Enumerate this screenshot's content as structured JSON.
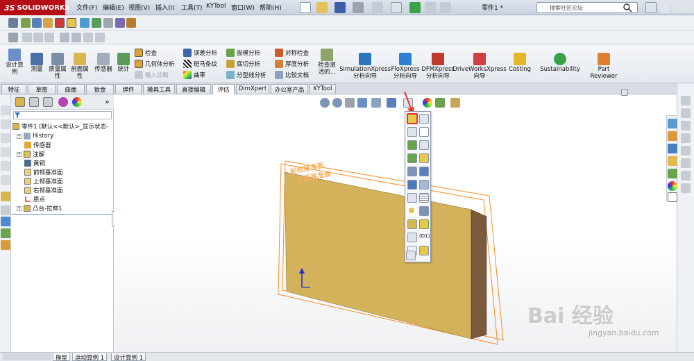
{
  "app": {
    "name": "SOLIDWORKS",
    "doc_title": "零件1 *"
  },
  "menu": [
    "文件(F)",
    "编辑(E)",
    "视图(V)",
    "插入(I)",
    "工具(T)",
    "KYTool",
    "窗口(W)",
    "帮助(H)"
  ],
  "search": {
    "placeholder": "搜索社区论坛"
  },
  "command_manager": {
    "big_buttons": [
      {
        "label": "设计算\n例"
      },
      {
        "label": "测量"
      },
      {
        "label": "质量属\n性"
      },
      {
        "label": "剖面属\n性"
      },
      {
        "label": "传感器"
      },
      {
        "label": "统计"
      }
    ],
    "col1": [
      {
        "label": "检查",
        "enabled": true
      },
      {
        "label": "几何体分析",
        "enabled": true
      },
      {
        "label": "输入诊断",
        "enabled": false
      }
    ],
    "col2": [
      {
        "label": "误差分析"
      },
      {
        "label": "斑马条纹"
      },
      {
        "label": "曲率"
      }
    ],
    "col3": [
      {
        "label": "拔模分析"
      },
      {
        "label": "底切分析"
      },
      {
        "label": "分型线分析"
      }
    ],
    "col4": [
      {
        "label": "对称检查"
      },
      {
        "label": "厚度分析"
      },
      {
        "label": "比较文档"
      }
    ],
    "check_active": "检查激\n活的...",
    "xpress": [
      {
        "label": "SimulationXpress\n分析向导"
      },
      {
        "label": "FloXpress\n分析向导"
      },
      {
        "label": "DFMXpress\n分析向导"
      },
      {
        "label": "DriveWorksXpress\n向导"
      },
      {
        "label": "Costing"
      },
      {
        "label": "Sustainability"
      },
      {
        "label": "Part\nReviewer"
      }
    ]
  },
  "tabs": [
    "特征",
    "草图",
    "曲面",
    "钣金",
    "焊件",
    "模具工具",
    "直接编辑",
    "评估",
    "DimXpert",
    "办公室产品",
    "KYTool"
  ],
  "active_tab": "评估",
  "tree": {
    "root": "零件1 (默认<<默认>_显示状态-",
    "items": [
      "History",
      "传感器",
      "注解",
      "黄铜",
      "前视基准面",
      "上视基准面",
      "右视基准面",
      "原点",
      "凸台-拉伸1"
    ]
  },
  "viewport": {
    "plane_labels": [
      "前视基准面",
      "上视基准面"
    ]
  },
  "bottom_tabs": [
    "模型",
    "运动算例 1",
    "设计算例 1"
  ],
  "watermark": {
    "main": "Bai 经验",
    "url": "jingyan.baidu.com"
  },
  "colors": {
    "brand_red": "#b50d16",
    "part_face": "#d4b25c",
    "part_side": "#7a5a3c",
    "plane_orange": "#ff8a1f",
    "highlight": "#e8332a"
  }
}
